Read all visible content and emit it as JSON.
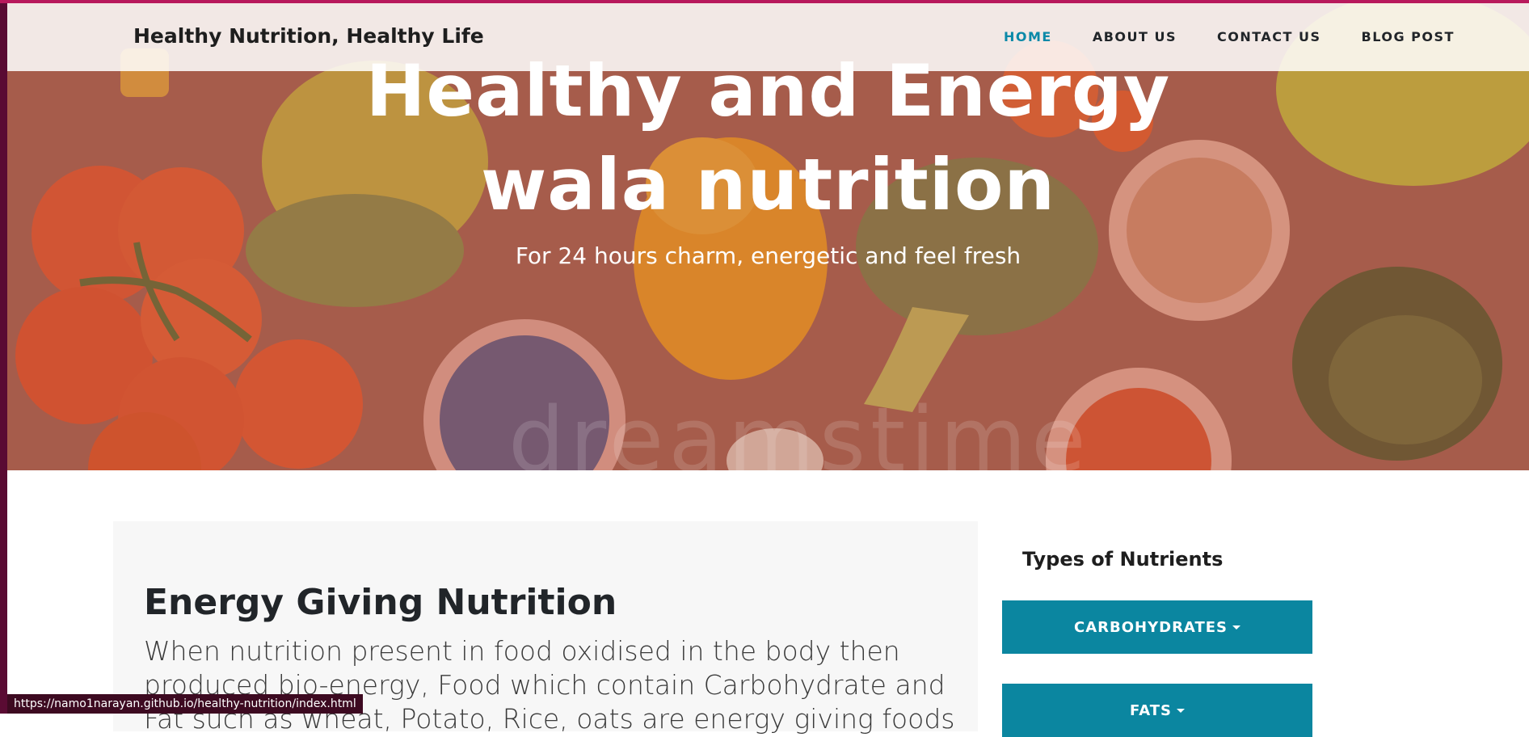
{
  "navbar": {
    "brand": "Healthy Nutrition, Healthy Life",
    "links": [
      {
        "label": "HOME",
        "active": true
      },
      {
        "label": "ABOUT US",
        "active": false
      },
      {
        "label": "CONTACT US",
        "active": false
      },
      {
        "label": "BLOG POST",
        "active": false
      }
    ]
  },
  "hero": {
    "title_line1": "Healthy and Energy",
    "title_line2": "wala nutrition",
    "subtitle": "For 24 hours charm, energetic and feel fresh",
    "watermark": "dreamstime"
  },
  "content": {
    "heading": "Energy Giving Nutrition",
    "paragraph": "When nutrition present in food oxidised in the body then produced bio-energy, Food which contain Carbohydrate and Fat such as wheat, Potato, Rice, oats are energy giving foods"
  },
  "sidebar": {
    "title": "Types of Nutrients",
    "buttons": [
      {
        "label": "CARBOHYDRATES"
      },
      {
        "label": "FATS"
      }
    ]
  },
  "status_bar": {
    "url": "https://namo1narayan.github.io/healthy-nutrition/index.html"
  },
  "colors": {
    "accent": "#0b86a0",
    "active_nav": "#0b89a8",
    "hero_tint": "#a75c4a",
    "top_strip": "#b8195c"
  }
}
